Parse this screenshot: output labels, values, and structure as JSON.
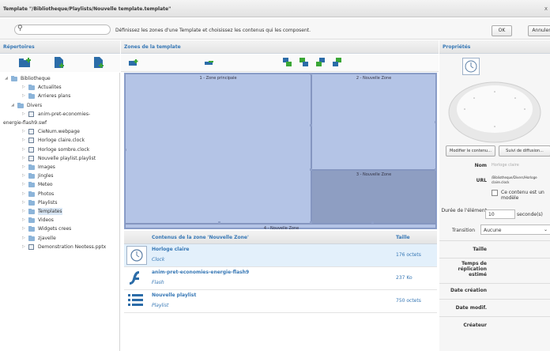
{
  "window": {
    "title": "Template \"/Bibliotheque/Playlists/Nouvelle template.template\"",
    "close": "x"
  },
  "toolbar": {
    "search_placeholder": "",
    "instruction": "Définissez les zones d'une Template et choisissez les contenus qui les composent.",
    "ok": "OK",
    "cancel": "Annuler"
  },
  "panels": {
    "left": "Répertoires",
    "middle": "Zones de la template",
    "right": "Propriétés"
  },
  "tree": [
    {
      "label": "Bibliotheque",
      "kind": "folder",
      "arrow": "◢"
    },
    {
      "label": "Actualites",
      "kind": "folder",
      "arrow": "▷"
    },
    {
      "label": "Arrieres plans",
      "kind": "folder",
      "arrow": "▷"
    },
    {
      "label": "Divers",
      "kind": "folder",
      "arrow": "◢"
    },
    {
      "label": "anim-pret-economies-",
      "kind": "file",
      "arrow": "▷"
    },
    {
      "label": "energie-flash9.swf",
      "kind": "none",
      "arrow": ""
    },
    {
      "label": "CieNum.webpage",
      "kind": "file",
      "arrow": "▷"
    },
    {
      "label": "Horloge claire.clock",
      "kind": "file",
      "arrow": "▷"
    },
    {
      "label": "Horloge sombre.clock",
      "kind": "file",
      "arrow": "▷"
    },
    {
      "label": "Nouvelle playlist.playlist",
      "kind": "file",
      "arrow": "▷"
    },
    {
      "label": "Images",
      "kind": "folder",
      "arrow": "▷"
    },
    {
      "label": "Jingles",
      "kind": "folder",
      "arrow": "▷"
    },
    {
      "label": "Meteo",
      "kind": "folder",
      "arrow": "▷"
    },
    {
      "label": "Photos",
      "kind": "folder",
      "arrow": "▷"
    },
    {
      "label": "Playlists",
      "kind": "folder",
      "arrow": "▷"
    },
    {
      "label": "Templates",
      "kind": "folder",
      "arrow": "▷"
    },
    {
      "label": "Videos",
      "kind": "folder",
      "arrow": "▷"
    },
    {
      "label": "Widgets crees",
      "kind": "folder",
      "arrow": "▷"
    },
    {
      "label": "zjavelle",
      "kind": "folder",
      "arrow": "▷"
    },
    {
      "label": "Demonstration Neotess.pptx",
      "kind": "file",
      "arrow": "▷"
    }
  ],
  "zones": [
    {
      "label": "1 - Zone principale"
    },
    {
      "label": "2 - Nouvelle Zone"
    },
    {
      "label": "3 - Nouvelle Zone"
    },
    {
      "label": "4 - Nouvelle Zone"
    }
  ],
  "contents": {
    "header": "Contenus de la zone 'Nouvelle Zone'",
    "size_header": "Taille",
    "rows": [
      {
        "name": "Horloge claire",
        "type": "Clock",
        "size": "176 octets",
        "icon": "clock-icon"
      },
      {
        "name": "anim-pret-economies-energie-flash9",
        "type": "Flash",
        "size": "237 Ko",
        "icon": "flash-icon"
      },
      {
        "name": "Nouvelle playlist",
        "type": "Playlist",
        "size": "750 octets",
        "icon": "playlist-icon"
      }
    ]
  },
  "properties": {
    "modify_button": "Modifier le contenu...",
    "broadcast_button": "Suivi de diffusion...",
    "name_label": "Nom",
    "name_value": "Horloge claire",
    "url_label": "URL",
    "url_value": "/Bibliotheque/Divers/Horloge claire.clock",
    "template_checkbox": "Ce contenu est un modèle",
    "duration_label": "Durée de l'élément",
    "duration_value": "10",
    "duration_unit": "seconde(s)",
    "transition_label": "Transition",
    "transition_value": "Aucune",
    "size_label": "Taille",
    "replication_label": "Temps de réplication estimé",
    "created_label": "Date création",
    "modified_label": "Date modif.",
    "creator_label": "Créateur"
  },
  "colors": {
    "accent": "#3677b5",
    "zone": "#b4c4e6",
    "zone_selected": "#8e9ec2",
    "selected_row": "#e3f0fb"
  }
}
